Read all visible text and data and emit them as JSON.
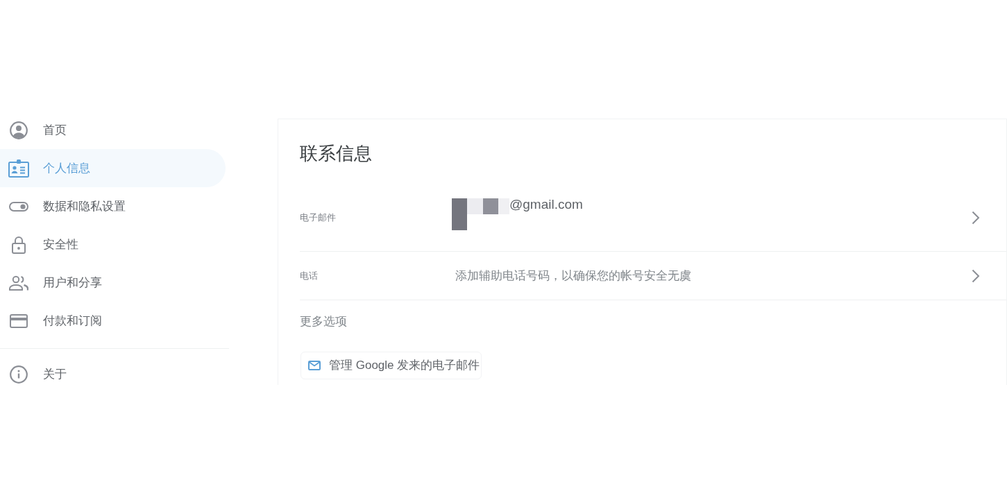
{
  "sidebar": {
    "items": [
      {
        "label": "首页",
        "selected": false
      },
      {
        "label": "个人信息",
        "selected": true
      },
      {
        "label": "数据和隐私设置",
        "selected": false
      },
      {
        "label": "安全性",
        "selected": false
      },
      {
        "label": "用户和分享",
        "selected": false
      },
      {
        "label": "付款和订阅",
        "selected": false
      }
    ],
    "footer_items": [
      {
        "label": "关于",
        "selected": false
      }
    ]
  },
  "contact_info": {
    "title": "联系信息",
    "rows": [
      {
        "kind": "email",
        "label": "电子邮件",
        "value": "@gmail.com"
      },
      {
        "kind": "phone",
        "label": "电话",
        "value": "添加辅助电话号码，以确保您的帐号安全无虞"
      }
    ],
    "more_options": {
      "title": "更多选项",
      "links": [
        "管理 Google 发来的电子邮件"
      ]
    }
  }
}
